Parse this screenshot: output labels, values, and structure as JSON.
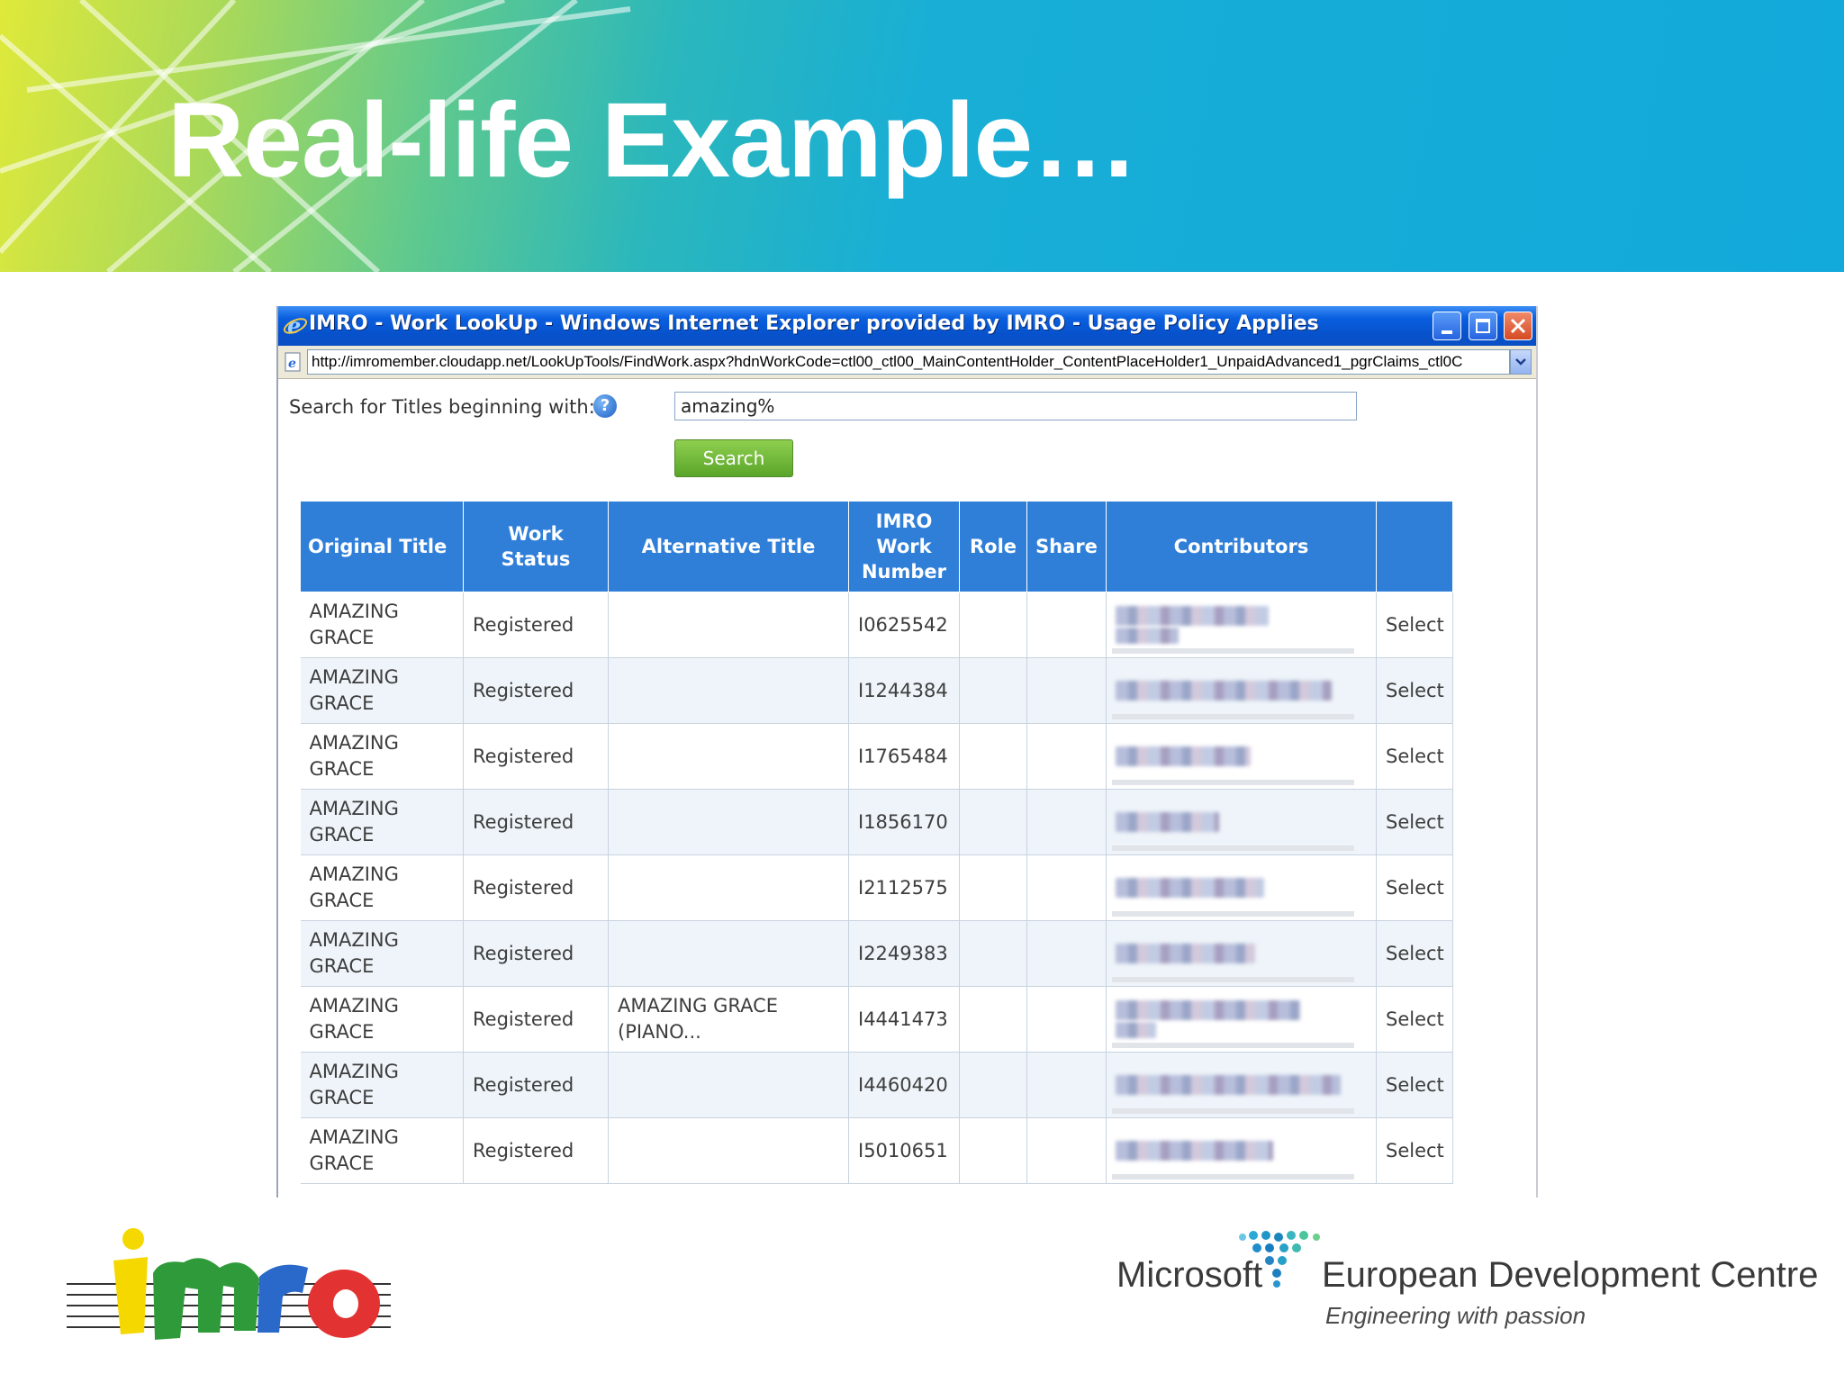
{
  "slide": {
    "title": "Real-life Example…"
  },
  "window": {
    "title": "IMRO - Work LookUp - Windows Internet Explorer provided by IMRO - Usage Policy Applies",
    "address": "http://imromember.cloudapp.net/LookUpTools/FindWork.aspx?hdnWorkCode=ctl00_ctl00_MainContentHolder_ContentPlaceHolder1_UnpaidAdvanced1_pgrClaims_ctl0C"
  },
  "search": {
    "label": "Search for Titles beginning with:",
    "help": "?",
    "value": "amazing%",
    "button": "Search"
  },
  "grid": {
    "headers": [
      "Original Title",
      "Work Status",
      "Alternative Title",
      "IMRO Work Number",
      "Role",
      "Share",
      "Contributors",
      ""
    ],
    "rows": [
      {
        "title": "AMAZING GRACE",
        "status": "Registered",
        "alt": "",
        "number": "I0625542",
        "select": "Select"
      },
      {
        "title": "AMAZING GRACE",
        "status": "Registered",
        "alt": "",
        "number": "I1244384",
        "select": "Select"
      },
      {
        "title": "AMAZING GRACE",
        "status": "Registered",
        "alt": "",
        "number": "I1765484",
        "select": "Select"
      },
      {
        "title": "AMAZING GRACE",
        "status": "Registered",
        "alt": "",
        "number": "I1856170",
        "select": "Select"
      },
      {
        "title": "AMAZING GRACE",
        "status": "Registered",
        "alt": "",
        "number": "I2112575",
        "select": "Select"
      },
      {
        "title": "AMAZING GRACE",
        "status": "Registered",
        "alt": "",
        "number": "I2249383",
        "select": "Select"
      },
      {
        "title": "AMAZING GRACE",
        "status": "Registered",
        "alt": "AMAZING GRACE (PIANO...",
        "number": "I4441473",
        "select": "Select"
      },
      {
        "title": "AMAZING GRACE",
        "status": "Registered",
        "alt": "",
        "number": "I4460420",
        "select": "Select"
      },
      {
        "title": "AMAZING GRACE",
        "status": "Registered",
        "alt": "",
        "number": "I5010651",
        "select": "Select"
      }
    ]
  },
  "logos": {
    "left": "imro",
    "microsoft": "Microsoft",
    "edc": "European Development Centre",
    "tagline": "Engineering with passion"
  },
  "colors": {
    "header_blue": "#2f7fd9",
    "link_blue": "#2a66c6",
    "button_green": "#5aa52a"
  }
}
